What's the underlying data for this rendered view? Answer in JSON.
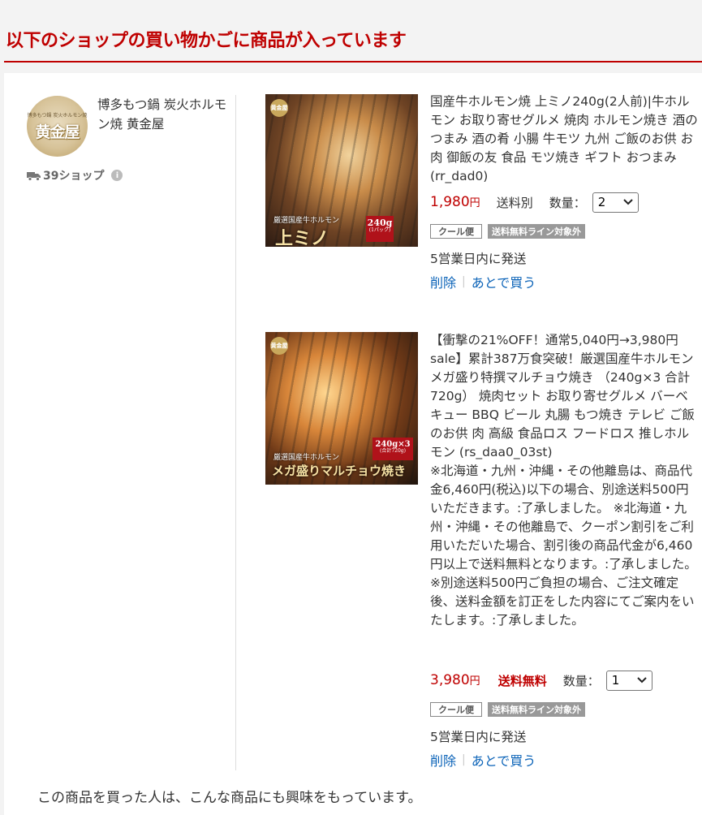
{
  "page": {
    "title": "以下のショップの買い物かごに商品が入っています",
    "recommend_text": "この商品を買った人は、こんな商品にも興味をもっています。"
  },
  "shop": {
    "name": "博多もつ鍋 炭火ホルモン焼 黄金屋",
    "logo_small": "博多もつ鍋 炭火ホルモン焼",
    "logo_text": "黄金屋",
    "shop_count": "39ショップ",
    "icons": [
      "truck-icon",
      "info-icon"
    ]
  },
  "items": [
    {
      "title": "国産牛ホルモン焼 上ミノ240g(2人前)|牛ホルモン お取り寄せグルメ 焼肉 ホルモン焼き 酒のつまみ 酒の肴 小腸 牛モツ 九州 ご飯のお供 お肉 御飯の友 食品 モツ焼き ギフト おつまみ (rr_dad0)",
      "image_badge": "黄金屋",
      "image_caption_small": "厳選国産牛ホルモン",
      "image_caption_big": "上ミノ",
      "image_weight": "240g",
      "image_weight_sub": "(1パック)",
      "price": "1,980",
      "currency": "円",
      "shipping": "送料別",
      "qty_label": "数量：",
      "qty_value": "2",
      "tag_cool": "クール便",
      "tag_free_line": "送料無料ライン対象外",
      "delivery": "5営業日内に発送",
      "delete_label": "削除",
      "later_label": "あとで買う"
    },
    {
      "title": "【衝撃の21%OFF！通常5,040円→3,980円sale】累計387万食突破！厳選国産牛ホルモン メガ盛り特撰マルチョウ焼き （240g×3 合計720g） 焼肉セット お取り寄せグルメ バーベキュー BBQ ビール 丸腸 もつ焼き テレビ ご飯のお供 肉 高級 食品ロス フードロス 推しホルモン (rs_daa0_03st)\n※北海道・九州・沖縄・その他離島は、商品代金6,460円(税込)以下の場合、別途送料500円いただきます。:了承しました。 ※北海道・九州・沖縄・その他離島で、クーポン割引をご利用いただいた場合、割引後の商品代金が6,460円以上で送料無料となります。:了承しました。 ※別途送料500円ご負担の場合、ご注文確定後、送料金額を訂正をした内容にてご案内をいたします。:了承しました。",
      "image_badge": "黄金屋",
      "image_caption_small": "厳選国産牛ホルモン",
      "image_caption_big": "メガ盛りマルチョウ焼き",
      "image_weight": "240g×3",
      "image_weight_sub": "(合計720g)",
      "price": "3,980",
      "currency": "円",
      "shipping": "送料無料",
      "qty_label": "数量：",
      "qty_value": "1",
      "tag_cool": "クール便",
      "tag_free_line": "送料無料ライン対象外",
      "delivery": "5営業日内に発送",
      "delete_label": "削除",
      "later_label": "あとで買う"
    }
  ],
  "colors": {
    "brand_red": "#bf0000",
    "link_blue": "#0b63b8",
    "tag_gray": "#999999"
  }
}
